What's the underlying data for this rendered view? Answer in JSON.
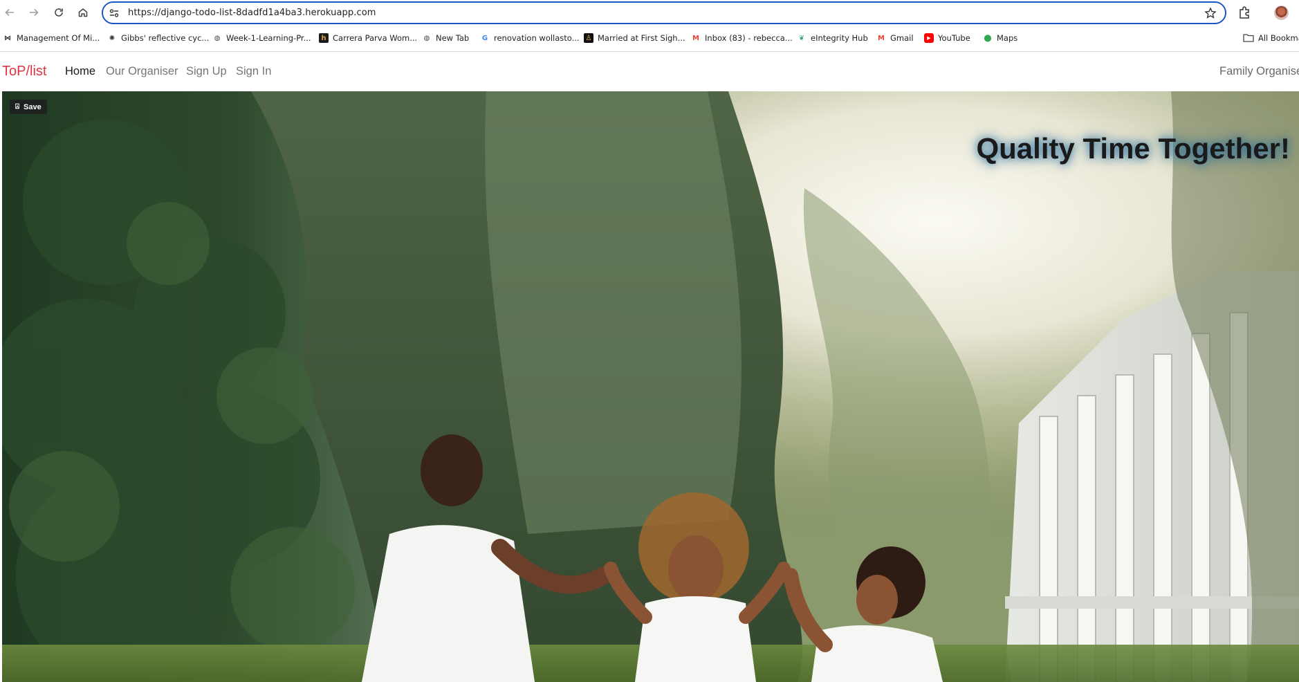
{
  "browser": {
    "url": "https://django-todo-list-8dadfd1a4ba3.herokuapp.com",
    "bookmarks": [
      {
        "label": "Management Of Mi...",
        "icon": "butterfly-icon",
        "color": "#2b2b2b"
      },
      {
        "label": "Gibbs' reflective cyc...",
        "icon": "globe-dark-icon",
        "color": "#333333"
      },
      {
        "label": "Week-1-Learning-Pr...",
        "icon": "globe-icon",
        "color": "#444444"
      },
      {
        "label": "Carrera Parva Wom...",
        "icon": "h-logo-icon",
        "color": "#c47a1a"
      },
      {
        "label": "New Tab",
        "icon": "globe-icon",
        "color": "#444444"
      },
      {
        "label": "renovation wollasto...",
        "icon": "google-icon",
        "color": "#4285f4"
      },
      {
        "label": "Married at First Sigh...",
        "icon": "figure-icon",
        "color": "#222222"
      },
      {
        "label": "Inbox (83) - rebecca...",
        "icon": "gmail-icon",
        "color": "#ea4335"
      },
      {
        "label": "eIntegrity Hub",
        "icon": "leaf-icon",
        "color": "#3aa17e"
      },
      {
        "label": "Gmail",
        "icon": "gmail-icon",
        "color": "#ea4335"
      },
      {
        "label": "YouTube",
        "icon": "youtube-icon",
        "color": "#ff0000"
      },
      {
        "label": "Maps",
        "icon": "maps-pin-icon",
        "color": "#34a853"
      }
    ],
    "all_bookmarks_label": "All Bookma"
  },
  "site": {
    "brand": "ToP/list",
    "brand_color": "#dc3545",
    "nav": [
      {
        "label": "Home",
        "active": true
      },
      {
        "label": "Our Organiser",
        "active": false
      },
      {
        "label": "Sign Up",
        "active": false
      },
      {
        "label": "Sign In",
        "active": false
      }
    ],
    "right_label": "Family Organise"
  },
  "hero": {
    "save_label": "Save",
    "title": "Quality Time Together!"
  }
}
